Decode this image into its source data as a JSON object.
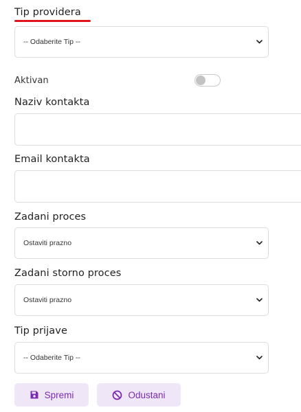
{
  "form": {
    "provider_type": {
      "label": "Tip providera",
      "selected": "-- Odaberite Tip --"
    },
    "active": {
      "label": "Aktivan",
      "checked": false
    },
    "contact_name": {
      "label": "Naziv kontakta",
      "value": ""
    },
    "contact_email": {
      "label": "Email kontakta",
      "value": ""
    },
    "default_process": {
      "label": "Zadani proces",
      "selected": "Ostaviti prazno"
    },
    "default_storno_process": {
      "label": "Zadani storno proces",
      "selected": "Ostaviti prazno"
    },
    "registration_type": {
      "label": "Tip prijave",
      "selected": "-- Odaberite Tip --"
    }
  },
  "actions": {
    "save_label": "Spremi",
    "save_icon": "floppy-disk-icon",
    "cancel_label": "Odustani",
    "cancel_icon": "prohibited-icon"
  },
  "colors": {
    "accent_underline": "#e0141e",
    "button_bg": "#efe6f7",
    "button_text": "#7b2bb3"
  }
}
